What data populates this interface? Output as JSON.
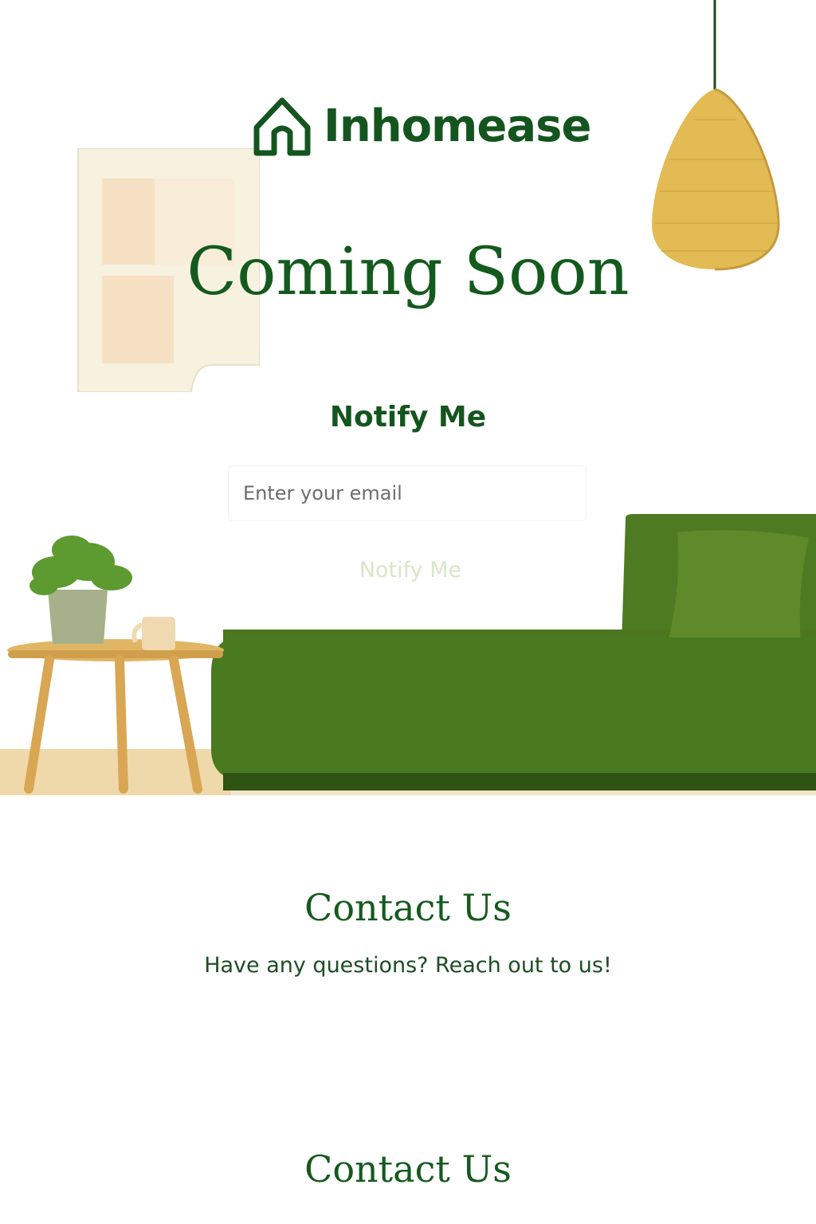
{
  "brand": {
    "name": "Inhomease",
    "icon": "house-icon"
  },
  "hero": {
    "title": "Coming Soon"
  },
  "notify": {
    "heading": "Notify Me",
    "email_placeholder": "Enter your email",
    "button_label": "Notify Me"
  },
  "contact": {
    "heading": "Contact Us",
    "text": "Have any questions? Reach out to us!",
    "heading_2": "Contact Us"
  },
  "colors": {
    "brand_green": "#14551f",
    "sofa_green": "#4f7a22",
    "wood": "#e2b96b"
  }
}
